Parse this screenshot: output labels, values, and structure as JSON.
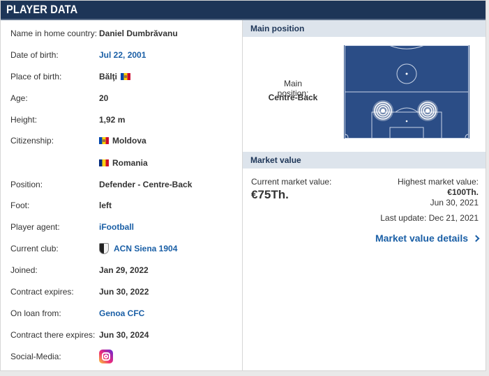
{
  "header": {
    "title": "PLAYER DATA"
  },
  "details": [
    {
      "label": "Name in home country:",
      "value": "Daniel Dumbrăvanu",
      "link": false
    },
    {
      "label": "Date of birth:",
      "value": "Jul 22, 2001",
      "link": true
    },
    {
      "label": "Place of birth:",
      "value": "Bălţi",
      "link": false,
      "flag": "moldova"
    },
    {
      "label": "Age:",
      "value": "20",
      "link": false
    },
    {
      "label": "Height:",
      "value": "1,92 m",
      "link": false
    },
    {
      "label": "Citizenship:",
      "value": "Moldova",
      "link": false,
      "flag": "moldova"
    },
    {
      "label": "",
      "value": "Romania",
      "link": false,
      "flag": "romania"
    },
    {
      "label": "Position:",
      "value": "Defender - Centre-Back",
      "link": false
    },
    {
      "label": "Foot:",
      "value": "left",
      "link": false
    },
    {
      "label": "Player agent:",
      "value": "iFootball",
      "link": true
    },
    {
      "label": "Current club:",
      "value": "ACN Siena 1904",
      "link": true,
      "icon": "club-crest-icon"
    },
    {
      "label": "Joined:",
      "value": "Jan 29, 2022",
      "link": false
    },
    {
      "label": "Contract expires:",
      "value": "Jun 30, 2022",
      "link": false
    },
    {
      "label": "On loan from:",
      "value": "Genoa CFC",
      "link": true
    },
    {
      "label": "Contract there expires:",
      "value": "Jun 30, 2024",
      "link": false
    },
    {
      "label": "Social-Media:",
      "value": "",
      "link": false,
      "icon": "instagram-icon"
    }
  ],
  "main_position": {
    "section_title": "Main position",
    "label": "Main position:",
    "value": "Centre-Back"
  },
  "market_value": {
    "section_title": "Market value",
    "current_label": "Current market value:",
    "current_value": "€75Th.",
    "highest_label": "Highest market value:",
    "highest_value": "€100Th.",
    "highest_date": "Jun 30, 2021",
    "last_update": "Last update: Dec 21, 2021",
    "details_link": "Market value details"
  },
  "colors": {
    "header_bg": "#1d3557",
    "link": "#1a5fa6",
    "pitch": "#2b4d86",
    "section_bg": "#dde4ec"
  }
}
